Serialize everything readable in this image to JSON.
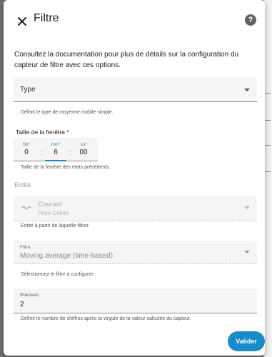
{
  "dialog": {
    "title": "Filtre",
    "intro": "Consultez la documentation pour plus de détails sur la configuration du capteur de filtre avec ces options."
  },
  "type_field": {
    "label": "Type",
    "helper": "Définit le type de moyenne mobile simple."
  },
  "window": {
    "label": "Taille de la fenêtre *",
    "hours_label": "hh*",
    "hours_value": "0",
    "minutes_label": "mm*",
    "minutes_value": "6",
    "seconds_label": "ss*",
    "seconds_value": "00",
    "separator": ":",
    "helper": "Taille de la fenêtre des états précédents."
  },
  "entity": {
    "section_label": "Entité",
    "name": "Courant",
    "sub": "Prise Cellier",
    "helper": "Entité à partir de laquelle filtrer."
  },
  "filter": {
    "label": "Filtre",
    "value": "Moving average (time-based)",
    "helper": "Sélectionnez le filtre à configurer."
  },
  "precision": {
    "label": "Précision",
    "value": "2",
    "helper": "Définit le nombre de chiffres après la virgule de la valeur calculée du capteur."
  },
  "actions": {
    "submit_label": "Valider"
  },
  "icons": {
    "close": "close-icon",
    "help": "help-circle-icon",
    "entity": "flash-icon",
    "dropdown": "chevron-down-icon"
  },
  "colors": {
    "accent": "#1a8bc9",
    "overlay": "#6f6f6f",
    "field_bg": "#f5f5f5"
  }
}
